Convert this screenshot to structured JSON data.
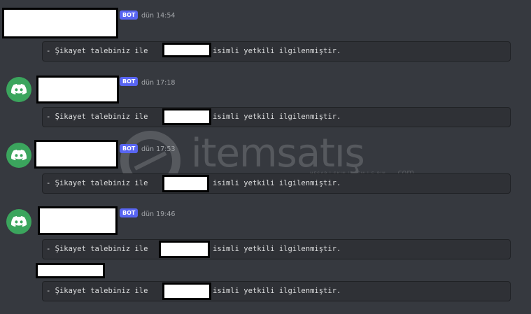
{
  "messages": [
    {
      "bot_tag": "BOT",
      "timestamp": "dün 14:54",
      "prefix": "- Şikayet talebiniz ile",
      "suffix": "isimli yetkili ilgilenmiştir."
    },
    {
      "bot_tag": "BOT",
      "timestamp": "dün 17:18",
      "prefix": "- Şikayet talebiniz ile",
      "suffix": "isimli yetkili ilgilenmiştir."
    },
    {
      "bot_tag": "BOT",
      "timestamp": "dün 17:53",
      "prefix": "- Şikayet talebiniz ile",
      "suffix": "isimli yetkili ilgilenmiştir."
    },
    {
      "bot_tag": "BOT",
      "timestamp": "dün 19:46",
      "prefix": "- Şikayet talebiniz ile",
      "suffix": "isimli yetkili ilgilenmiştir."
    },
    {
      "prefix": "- Şikayet talebiniz ile",
      "suffix": "isimli yetkili ilgilenmiştir."
    }
  ],
  "watermark": {
    "brand": "itemsatış",
    "tagline": "HESAP | SKIN | ITEM | E-PIN",
    "domain": ".com"
  },
  "colors": {
    "background": "#36393f",
    "bot_tag": "#5865f2",
    "avatar": "#3ba55d",
    "code_block": "#2f3136"
  },
  "icons": {
    "avatar": "discord-logo-icon"
  }
}
